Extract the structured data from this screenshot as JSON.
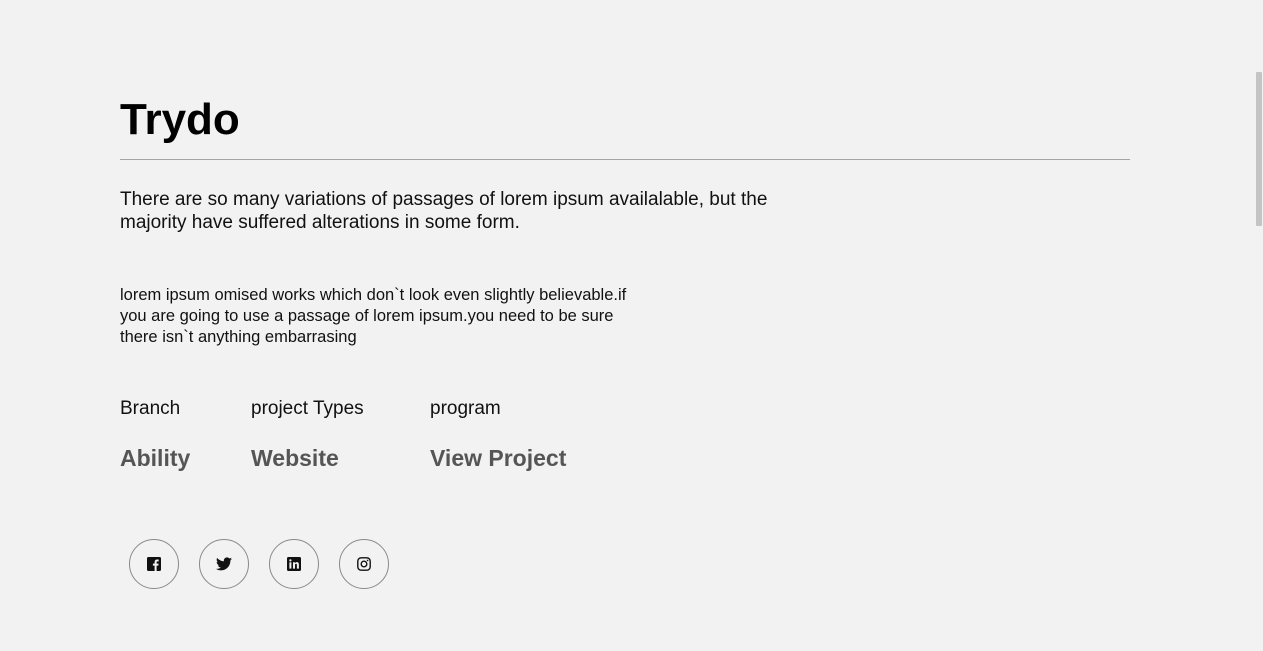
{
  "project": {
    "title": "Trydo",
    "lead": "There are so many variations of passages of lorem ipsum availalable, but the majority have suffered alterations in some form.",
    "description": "lorem ipsum omised works which don`t look even slightly believable.if you are going to use a passage of lorem ipsum.you need to be sure there isn`t anything embarrasing"
  },
  "meta": [
    {
      "label": "Branch",
      "value": "Ability"
    },
    {
      "label": "project Types",
      "value": "Website"
    },
    {
      "label": "program",
      "value": "View Project"
    }
  ],
  "social": [
    {
      "icon": "facebook-icon"
    },
    {
      "icon": "twitter-icon"
    },
    {
      "icon": "linkedin-icon"
    },
    {
      "icon": "instagram-icon"
    }
  ],
  "colors": {
    "background": "#f2f2f2",
    "title": "#000000",
    "text": "#111111",
    "meta_value": "#555555",
    "divider": "#a5a5a5",
    "circle_border": "#8a8a8a"
  }
}
